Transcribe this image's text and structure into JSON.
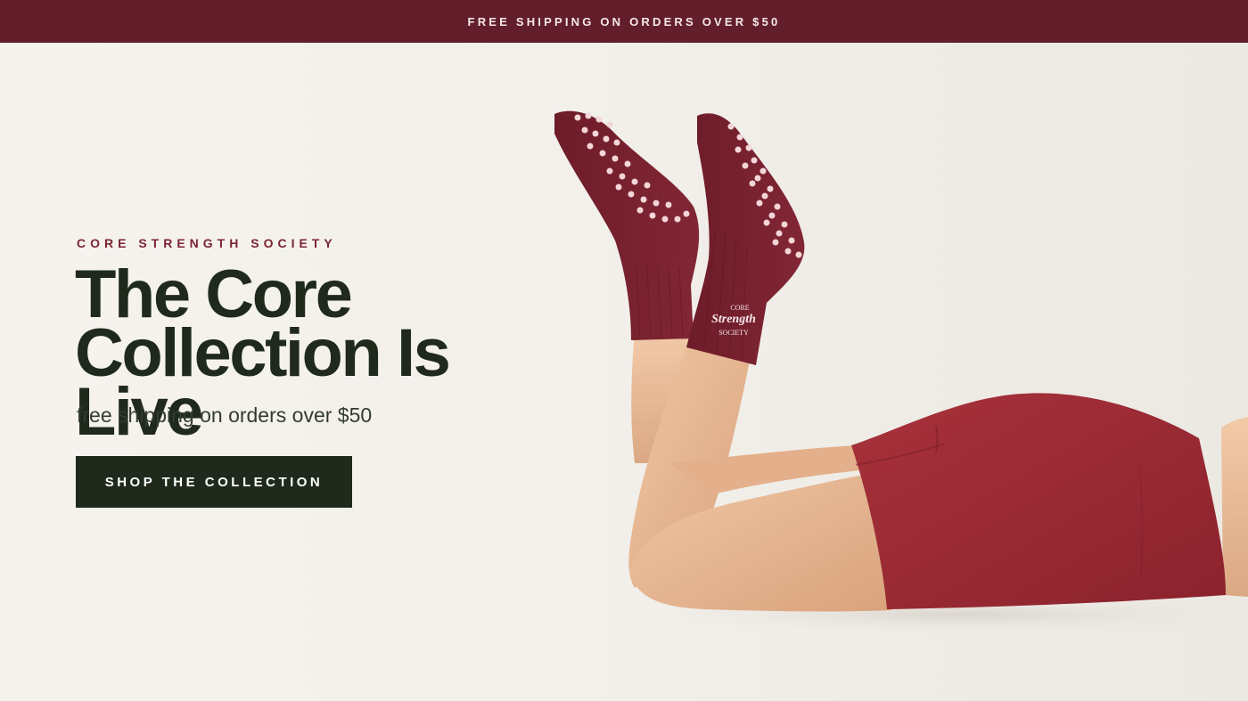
{
  "announcement": {
    "text": "FREE SHIPPING ON ORDERS OVER $50"
  },
  "hero": {
    "eyebrow": "CORE STRENGTH SOCIETY",
    "headline_line1": "The Core",
    "headline_line2": "Collection Is Live",
    "subhead": "free shipping on orders over $50",
    "cta_label": "SHOP THE COLLECTION",
    "image": {
      "subject": "legs-in-grip-socks-and-shorts",
      "sock_logo_text": "CORE Strength SOCIETY"
    }
  },
  "colors": {
    "announcement_bg": "#621e2a",
    "accent_maroon": "#7b2433",
    "text_dark": "#1f2a1c",
    "button_bg": "#1f2a1c",
    "sock_color": "#7a2231",
    "shorts_color": "#9b2a34",
    "background": "#f4f1ec"
  }
}
